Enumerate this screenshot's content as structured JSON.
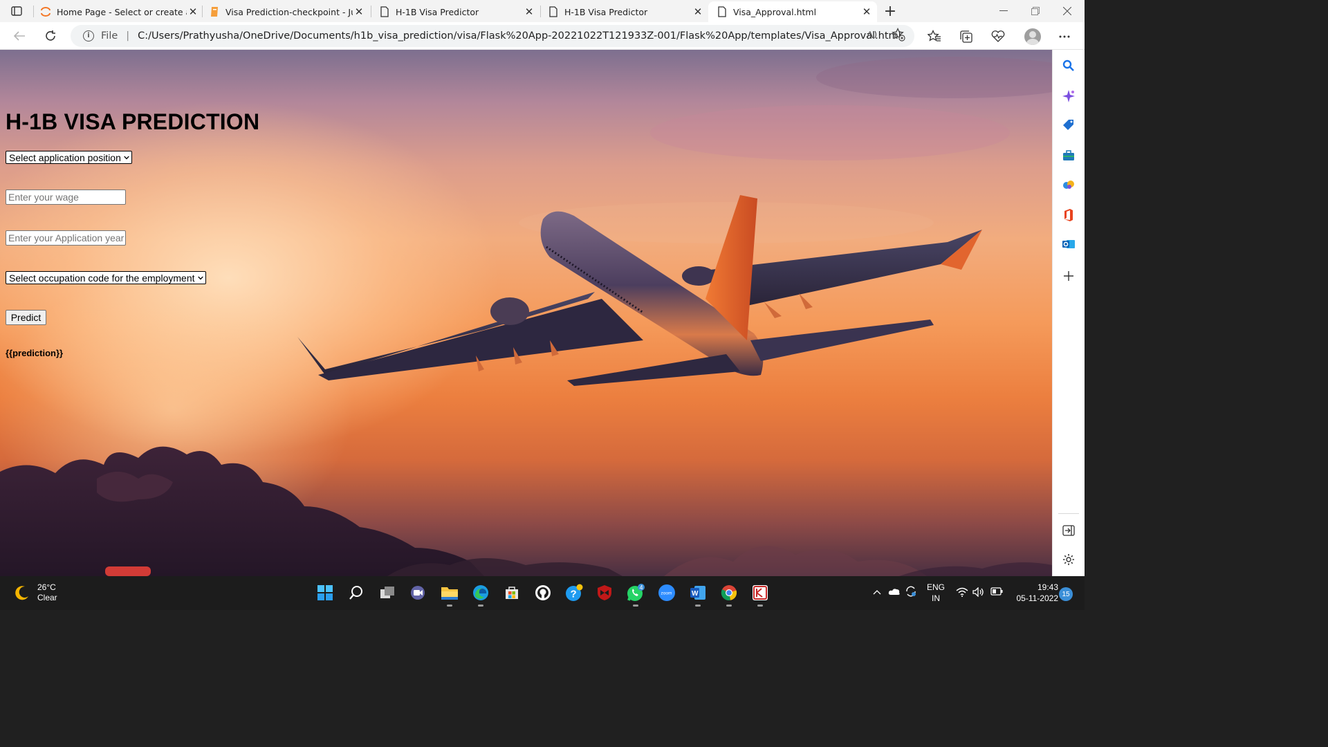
{
  "browser": {
    "tabs": [
      {
        "title": "Home Page - Select or create a n",
        "icon": "jupyter-icon"
      },
      {
        "title": "Visa Prediction-checkpoint - Jup",
        "icon": "notebook-icon"
      },
      {
        "title": "H-1B Visa Predictor",
        "icon": "page-icon"
      },
      {
        "title": "H-1B Visa Predictor",
        "icon": "page-icon"
      },
      {
        "title": "Visa_Approval.html",
        "icon": "page-icon",
        "active": true
      }
    ],
    "address": {
      "scheme_label": "File",
      "url": "C:/Users/Prathyusha/OneDrive/Documents/h1b_visa_prediction/visa/Flask%20App-20221022T121933Z-001/Flask%20App/templates/Visa_Approval.html"
    }
  },
  "page": {
    "heading": "H-1B VISA PREDICTION",
    "position_select": {
      "selected": "Select application position"
    },
    "wage_input": {
      "placeholder": "Enter your wage"
    },
    "year_input": {
      "placeholder": "Enter your Application year"
    },
    "occupation_select": {
      "selected": "Select occupation code for the employment"
    },
    "predict_button": "Predict",
    "prediction_text": "{{prediction}}"
  },
  "sidebar": {
    "icons": [
      "search-icon",
      "copilot-icon",
      "shopping-tag-icon",
      "tools-icon",
      "games-icon",
      "office-icon",
      "outlook-icon",
      "add-icon",
      "hide-sidebar-icon",
      "settings-icon"
    ]
  },
  "taskbar": {
    "weather": {
      "temperature": "26°C",
      "condition": "Clear"
    },
    "apps": [
      "windows-start-icon",
      "search-icon",
      "task-view-icon",
      "teams-chat-icon",
      "file-explorer-icon",
      "edge-icon",
      "store-icon",
      "github-icon",
      "help-icon",
      "mcafee-icon",
      "whatsapp-icon",
      "zoom-icon",
      "word-icon",
      "chrome-icon",
      "app-icon"
    ],
    "whatsapp_badge": "4",
    "zoom_label": "zoom",
    "word_letter": "W",
    "language": {
      "line1": "ENG",
      "line2": "IN"
    },
    "clock": {
      "time": "19:43",
      "date": "05-11-2022"
    },
    "notifications": "15"
  },
  "colors": {
    "sky_top": "#7d6f8f",
    "sky_mid": "#f2ac7e",
    "sky_bottom": "#4a3042",
    "tail_orange": "#e8602a",
    "accent_blue": "#1a73e8"
  }
}
